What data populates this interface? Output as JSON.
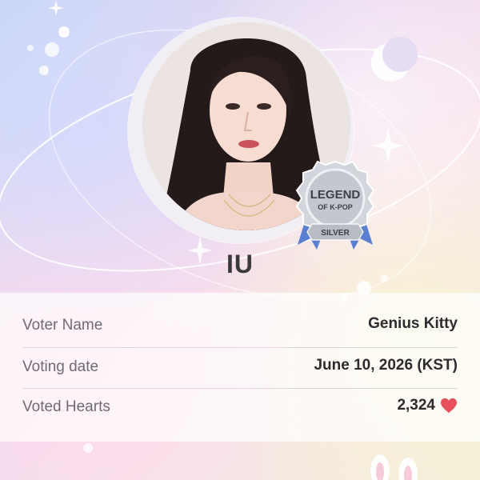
{
  "artist": {
    "name": "IU"
  },
  "badge": {
    "line1": "LEGEND",
    "line2": "OF K-POP",
    "tier": "SILVER"
  },
  "vote_info": {
    "rows": [
      {
        "label": "Voter Name",
        "value": "Genius Kitty"
      },
      {
        "label": "Voting date",
        "value": "June 10, 2026 (KST)"
      },
      {
        "label": "Voted Hearts",
        "value": "2,324"
      }
    ]
  },
  "icons": {
    "heart": "heart-icon",
    "moon": "crescent-moon-icon",
    "sparkle": "sparkle-icon"
  },
  "colors": {
    "heart": "#e8505b",
    "badge_silver": "#c9ccd3",
    "badge_ribbon": "#5b7fd1",
    "text_primary": "#2d2b2e",
    "text_secondary": "#6f6a70"
  }
}
